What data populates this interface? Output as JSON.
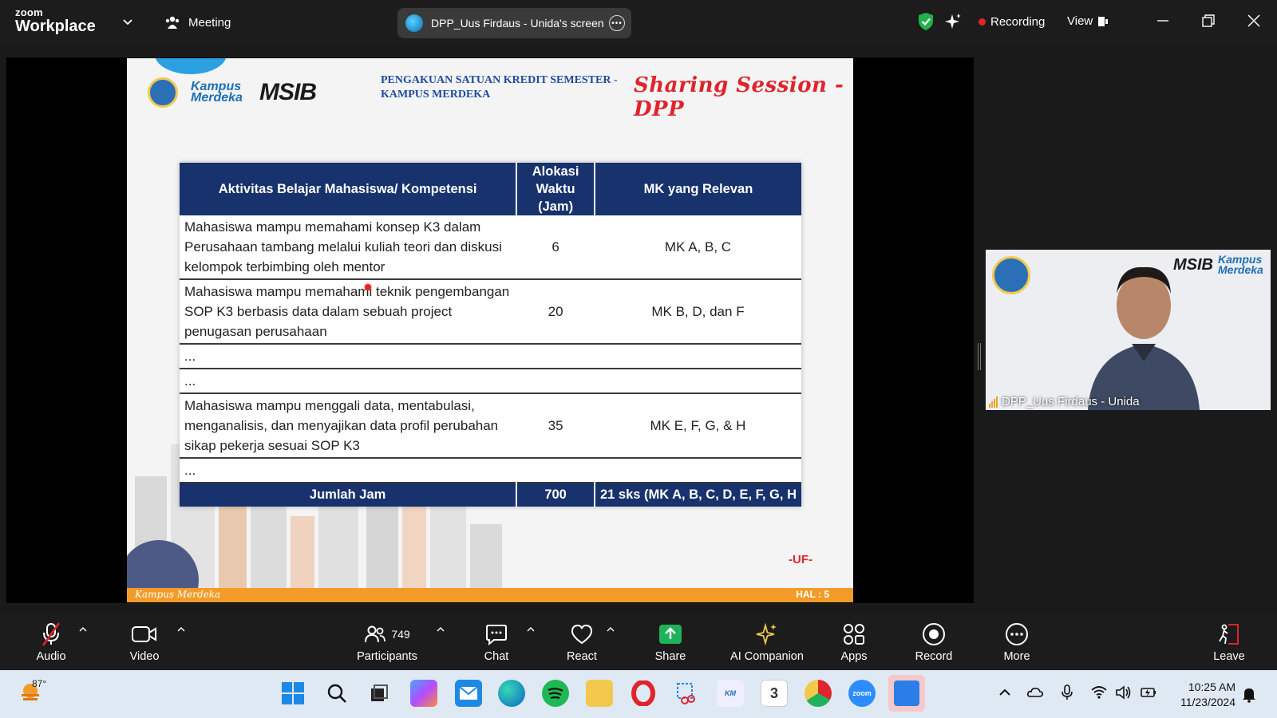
{
  "app": {
    "logo_line1": "zoom",
    "logo_line2": "Workplace",
    "meeting_label": "Meeting",
    "share_title": "DPP_Uus Firdaus - Unida's screen",
    "recording_label": "Recording",
    "view_label": "View"
  },
  "slide": {
    "logo_kampus": "Kampus Merdeka",
    "logo_msib": "MSIB",
    "heading_line1": "PENGAKUAN SATUAN KREDIT SEMESTER -",
    "heading_line2": "KAMPUS MERDEKA",
    "session_title": "Sharing Session - DPP",
    "table": {
      "headers": [
        "Aktivitas Belajar Mahasiswa/ Kompetensi",
        "Alokasi Waktu (Jam)",
        "MK yang Relevan"
      ],
      "rows": [
        {
          "activity": "Mahasiswa mampu memahami konsep K3 dalam Perusahaan tambang melalui kuliah teori dan diskusi kelompok terbimbing oleh mentor",
          "hours": "6",
          "mk": "MK A, B, C"
        },
        {
          "activity": "Mahasiswa mampu memahami teknik pengembangan SOP K3 berbasis data dalam sebuah project penugasan perusahaan",
          "hours": "20",
          "mk": "MK B, D, dan F"
        },
        {
          "activity": "...",
          "hours": "",
          "mk": ""
        },
        {
          "activity": "...",
          "hours": "",
          "mk": ""
        },
        {
          "activity": "Mahasiswa mampu menggali data, mentabulasi, menganalisis, dan menyajikan data profil perubahan sikap pekerja sesuai SOP K3",
          "hours": "35",
          "mk": "MK E, F, G, & H"
        },
        {
          "activity": "...",
          "hours": "",
          "mk": ""
        }
      ],
      "footer": {
        "label": "Jumlah Jam",
        "hours": "700",
        "mk": "21 sks (MK A, B, C, D, E, F, G, H"
      }
    },
    "footer_left": "Kampus Merdeka",
    "footer_right": "HAL : 5",
    "uf_mark": "-UF-"
  },
  "video": {
    "participant_name": "DPP_Uus Firdaus - Unida"
  },
  "toolbar": {
    "audio": "Audio",
    "video": "Video",
    "participants": "Participants",
    "participants_count": "749",
    "chat": "Chat",
    "react": "React",
    "share": "Share",
    "ai_companion": "AI Companion",
    "apps": "Apps",
    "record": "Record",
    "more": "More",
    "leave": "Leave"
  },
  "taskbar": {
    "temperature": "87°",
    "time": "10:25 AM",
    "date": "11/23/2024"
  },
  "colors": {
    "zoom_bg": "#1c1c1c",
    "table_header": "#17326c",
    "slide_accent": "#f39b2a",
    "share_green": "#1fb25a",
    "recording_red": "#e0242b"
  }
}
